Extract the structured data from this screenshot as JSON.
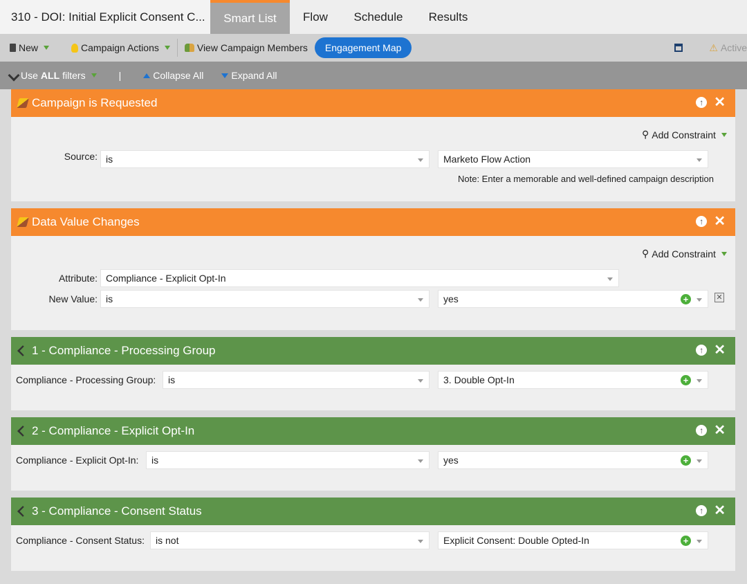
{
  "tabs": {
    "title": "310 - DOI: Initial Explicit Consent C...",
    "smart_list": "Smart List",
    "flow": "Flow",
    "schedule": "Schedule",
    "results": "Results"
  },
  "toolbar": {
    "new_label": "New",
    "campaign_actions_label": "Campaign Actions",
    "view_members_label": "View Campaign Members",
    "engagement_map_label": "Engagement Map",
    "status_label": "Active"
  },
  "filterbar": {
    "use_prefix": "Use",
    "use_bold": "ALL",
    "use_suffix": "filters",
    "divider": "|",
    "collapse_label": "Collapse All",
    "expand_label": "Expand All"
  },
  "common": {
    "add_constraint": "Add Constraint"
  },
  "blocks": [
    {
      "title": "Campaign is Requested",
      "rows": [
        {
          "label": "Source:",
          "operator": "is",
          "value": "Marketo Flow Action"
        }
      ],
      "note": "Note: Enter a memorable and well-defined campaign description"
    },
    {
      "title": "Data Value Changes",
      "rows": [
        {
          "label": "Attribute:",
          "value": "Compliance - Explicit Opt-In"
        },
        {
          "label": "New Value:",
          "operator": "is",
          "value": "yes"
        }
      ]
    },
    {
      "title": "1 - Compliance - Processing Group",
      "rows": [
        {
          "label": "Compliance - Processing Group:",
          "operator": "is",
          "value": "3. Double Opt-In"
        }
      ]
    },
    {
      "title": "2 - Compliance - Explicit Opt-In",
      "rows": [
        {
          "label": "Compliance - Explicit Opt-In:",
          "operator": "is",
          "value": "yes"
        }
      ]
    },
    {
      "title": "3 - Compliance - Consent Status",
      "rows": [
        {
          "label": "Compliance - Consent Status:",
          "operator": "is not",
          "value": "Explicit Consent: Double Opted-In"
        }
      ]
    }
  ],
  "colors": {
    "trigger_header": "#f6892e",
    "filter_header": "#5d944a",
    "accent_blue": "#1d73d1"
  }
}
